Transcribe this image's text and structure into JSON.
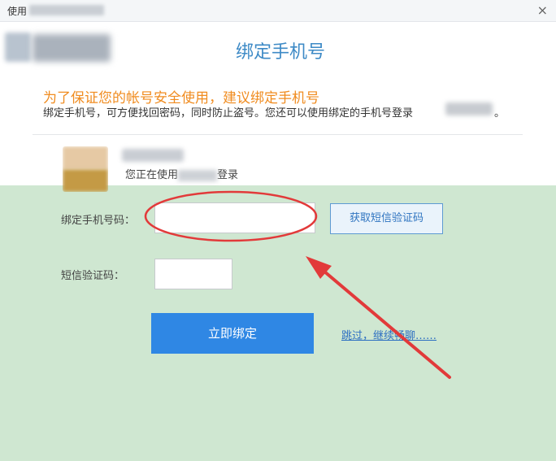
{
  "window": {
    "title": "使用",
    "close_glyph": "×"
  },
  "header": {
    "heading": "绑定手机号"
  },
  "intro": {
    "slogan": "为了保证您的帐号安全使用，建议绑定手机号",
    "description": "绑定手机号，可方便找回密码，同时防止盗号。您还可以使用绑定的手机号登录",
    "description_tail": "。"
  },
  "account": {
    "using_prefix": "您正在使用",
    "using_suffix": "登录"
  },
  "form": {
    "phone_label": "绑定手机号码：",
    "phone_value": "",
    "get_code_label": "获取短信验证码",
    "code_label": "短信验证码：",
    "code_value": "",
    "submit_label": "立即绑定",
    "skip_label": "跳过，继续畅聊……"
  },
  "colors": {
    "accent": "#2f87e4",
    "heading": "#3d8ac6",
    "slogan": "#f08c20",
    "form_background": "#cfe7d1",
    "annotation": "#e23a3a"
  }
}
